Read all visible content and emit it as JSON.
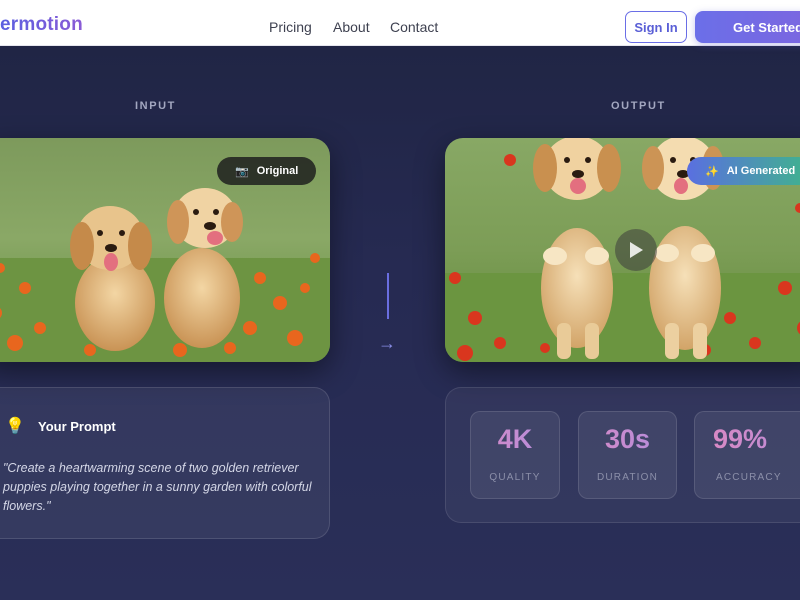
{
  "nav": {
    "logo": "ermotion",
    "links": [
      "Pricing",
      "About",
      "Contact"
    ],
    "sign_in": "Sign In",
    "get_started": "Get Started"
  },
  "input": {
    "label": "INPUT",
    "tag": "Original",
    "tag_icon": "camera-icon"
  },
  "output": {
    "label": "OUTPUT",
    "tag": "AI Generated",
    "tag_icon": "sparkle-icon"
  },
  "prompt": {
    "icon": "lightbulb-icon",
    "title": "Your Prompt",
    "text": "\"Create a heartwarming scene of two golden retriever puppies playing together in a sunny garden with colorful flowers.\""
  },
  "stats": [
    {
      "value": "4K",
      "label": "QUALITY"
    },
    {
      "value": "30s",
      "label": "DURATION"
    },
    {
      "value": "99%",
      "label": "ACCURACY"
    }
  ],
  "colors": {
    "accent": "#6b6fe8",
    "background": "#262a52",
    "stat_gradient_start": "#d889c4",
    "ai_tag_start": "#5a6fe0",
    "ai_tag_end": "#3fb58b"
  }
}
